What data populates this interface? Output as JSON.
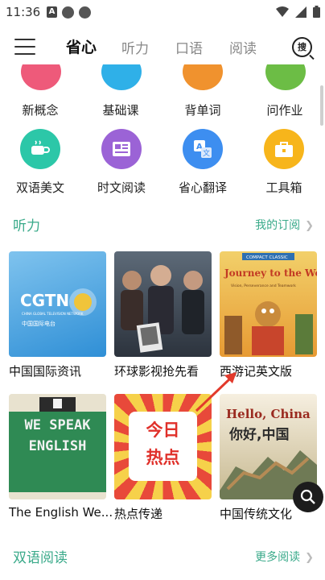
{
  "status_bar": {
    "time": "11:36",
    "app_badge": "A"
  },
  "nav": {
    "tabs": [
      {
        "label": "省心"
      },
      {
        "label": "听力"
      },
      {
        "label": "口语"
      },
      {
        "label": "阅读"
      }
    ],
    "search_label": "搜"
  },
  "top_row": [
    {
      "label": "新概念",
      "icon": "book-icon",
      "color": "#ee5a7a"
    },
    {
      "label": "基础课",
      "icon": "pencil-icon",
      "color": "#2fb0e8"
    },
    {
      "label": "背单词",
      "icon": "cards-icon",
      "color": "#f0922e"
    },
    {
      "label": "问作业",
      "icon": "homework-icon",
      "color": "#6cbd45"
    }
  ],
  "grid_row": [
    {
      "label": "双语美文",
      "icon": "cup-icon",
      "color": "#2cc7a8"
    },
    {
      "label": "时文阅读",
      "icon": "newspaper-icon",
      "color": "#9b63d6"
    },
    {
      "label": "省心翻译",
      "icon": "translate-icon",
      "color": "#3d8ef0"
    },
    {
      "label": "工具箱",
      "icon": "toolbox-icon",
      "color": "#f7b51b"
    }
  ],
  "listening": {
    "title": "听力",
    "link": "我的订阅",
    "cards": [
      {
        "title": "中国国际资讯",
        "art": "CGTN",
        "art_sub": "CHINA GLOBAL TELEVISION NETWORK",
        "art_sub2": "中国国际电台"
      },
      {
        "title": "环球影视抢先看",
        "art": ""
      },
      {
        "title": "西游记英文版",
        "art": "Journey to the West",
        "art_sub": "COMPACT CLASSIC",
        "art_sub2": "Vision, Perseverance and Teamwork"
      },
      {
        "title": "The English We...",
        "art": "WE SPEAK ENGLISH"
      },
      {
        "title": "热点传递",
        "art": "今日热点"
      },
      {
        "title": "中国传统文化",
        "art": "Hello, China",
        "art_sub": "你好,中国"
      }
    ]
  },
  "reading": {
    "title": "双语阅读",
    "link": "更多阅读"
  }
}
